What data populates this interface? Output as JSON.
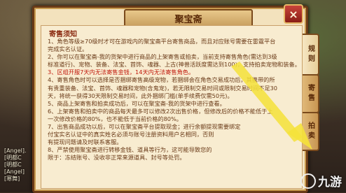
{
  "window": {
    "title": "聚宝斋"
  },
  "section_title": "寄售须知",
  "rules": [
    "1、角色等级≥70级时才可在游戏内的聚宝斋平台寄售商品，而且对应账号需要在雷霆平台",
    "完成实名认证。",
    "2、你可以在聚宝斋-我的货架中进行商品的上架寄售或拍卖，当前支持寄售角色(需达到3级",
    "标准道行)、宠物、装备、法宝、首饰、魂器、上古(神兽活跃度需达到100)，支持拍卖宠物和装备。",
    "3、区组开服7天内无法寄售金钱，14天内无法寄售角色。",
    "4、寄售角色时可以选择是否捆绑寄售高级宠物，若捆绑会在角色交易成功后，其携带的所",
    "有贵重装备、法宝、首饰、魂器和宠物(含鬼宠)，若无限制交易时间或限制交易时间不足30",
    "天，将统一获得30天限制交易时间，此外捆绑门槛(单手续费仅需50元)。",
    "5、商品上架寄售和拍卖成功后，可以在聚宝斋-我的货架中进行查看。",
    "6、上架寄售和拍卖中的商品每天最多可以修改2次出售价格，但修改后的价格不能低于上",
    "一次修改价格的80%，也不能低于当前价格的80%。",
    "7、出售商品成功以后，可以在聚宝斋平台提取现金；进行余额提现需要绑定",
    "付宝实名认证中的真实姓名必须与账号注册资料用户名相同，否则",
    "有提现问题请及时联系客服。",
    "8、严禁使用聚宝斋进行转移金钱、道具等行为，这可能导致您的",
    "限于：冻结账号、没收非正常来源道具、封号等处罚。"
  ],
  "tabs": [
    {
      "label": "规则",
      "active": true
    },
    {
      "label": "寄售",
      "active": false
    },
    {
      "label": "拍卖",
      "active": false
    }
  ],
  "chat_lines": [
    "[Angel].",
    "[明都C",
    "[明都C",
    "[Angel]",
    "[寒舞]"
  ],
  "close_label": "×",
  "watermark": {
    "text": "九游"
  },
  "colors": {
    "panel_bg": "#f3e2bd",
    "title_text": "#5a2a08",
    "highlight": "#c0180c",
    "arrow": "#f5e23a"
  }
}
